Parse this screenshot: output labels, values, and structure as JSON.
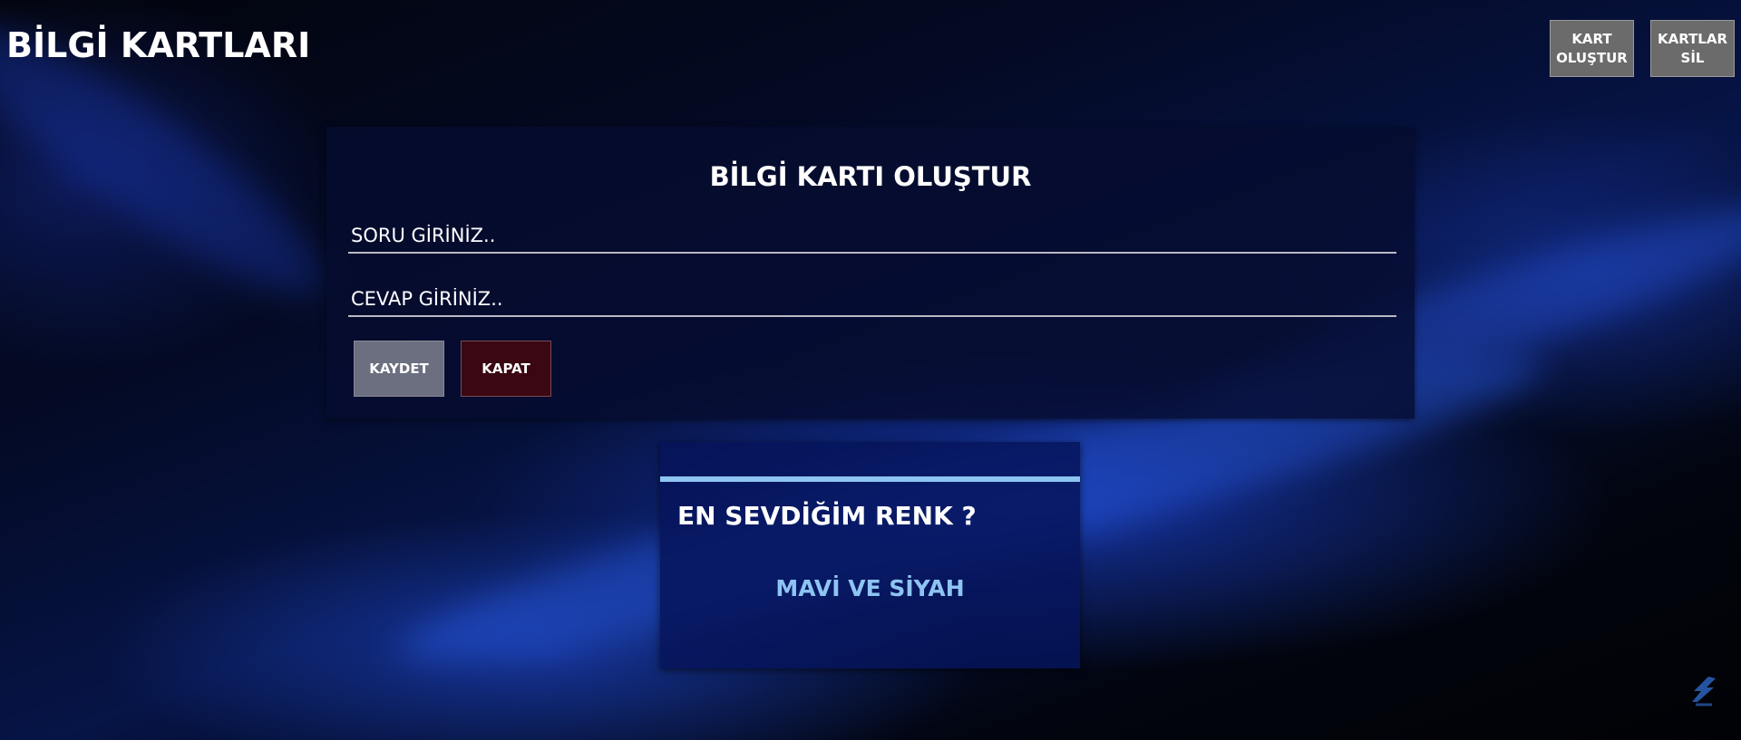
{
  "app": {
    "title": "BİLGİ KARTLARI"
  },
  "header": {
    "create_button_label": "KART\nOLUŞTUR",
    "delete_button_label": "KARTLAR\nSİL"
  },
  "form": {
    "title": "BİLGİ KARTI OLUŞTUR",
    "question_placeholder": "SORU GİRİNİZ..",
    "question_value": "",
    "answer_placeholder": "CEVAP GİRİNİZ..",
    "answer_value": "",
    "save_label": "KAYDET",
    "close_label": "KAPAT"
  },
  "cards": [
    {
      "question": "EN SEVDİĞİM RENK ?",
      "answer": "MAVİ VE SİYAH"
    }
  ],
  "colors": {
    "accent": "#8ec4f2",
    "save_button": "#6c6f80",
    "close_button": "#3a0713",
    "top_button": "#6b6b6b"
  },
  "icons": {
    "corner": "stylized-s-logo"
  }
}
